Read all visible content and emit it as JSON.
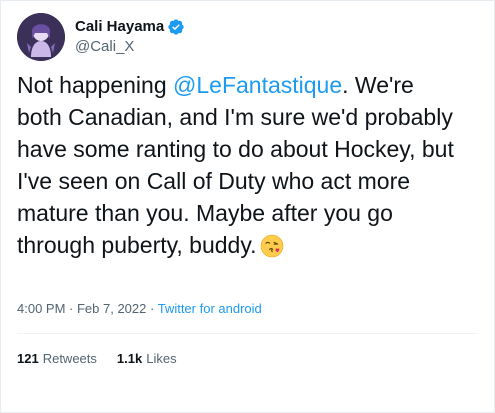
{
  "user": {
    "display_name": "Cali Hayama",
    "handle": "@Cali_X",
    "verified": true,
    "avatar_icon": "avatar-icon"
  },
  "tweet": {
    "text_before": "Not happening ",
    "mention": "@LeFantastique",
    "text_after": ". We're both Canadian, and I'm sure we'd probably have some ranting to do about Hockey, but I've seen on Call of Duty who act more mature than you. Maybe after you go through puberty, buddy.",
    "emoji": "face-blowing-a-kiss-emoji"
  },
  "meta": {
    "time": "4:00 PM",
    "separator1": " · ",
    "date": "Feb 7, 2022",
    "separator2": " · ",
    "source": "Twitter for android"
  },
  "stats": {
    "retweets_count": "121",
    "retweets_label": "Retweets",
    "likes_count": "1.1k",
    "likes_label": "Likes"
  },
  "colors": {
    "accent": "#1d9bf0",
    "text": "#0f1419",
    "secondary": "#536471",
    "border": "#e6ecf0"
  }
}
